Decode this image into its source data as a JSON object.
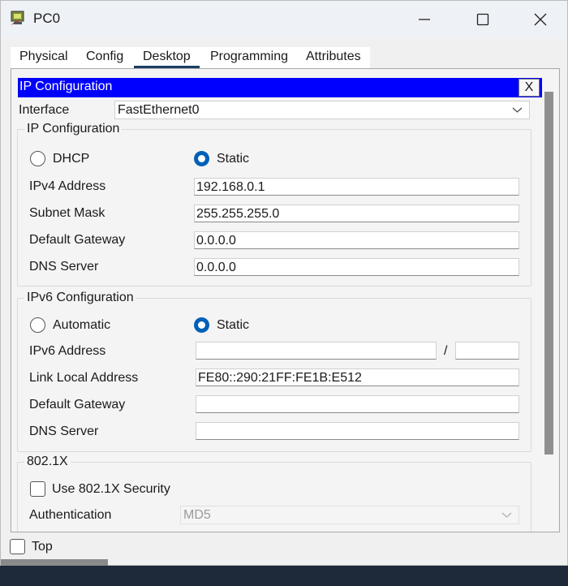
{
  "window": {
    "title": "PC0"
  },
  "tabs": [
    "Physical",
    "Config",
    "Desktop",
    "Programming",
    "Attributes"
  ],
  "active_tab": "Desktop",
  "panel": {
    "header_title": "IP Configuration",
    "close_label": "X",
    "interface_label": "Interface",
    "interface_value": "FastEthernet0"
  },
  "ipv4": {
    "group_title": "IP Configuration",
    "dhcp_label": "DHCP",
    "static_label": "Static",
    "selected": "Static",
    "address_label": "IPv4 Address",
    "address_value": "192.168.0.1",
    "mask_label": "Subnet Mask",
    "mask_value": "255.255.255.0",
    "gateway_label": "Default Gateway",
    "gateway_value": "0.0.0.0",
    "dns_label": "DNS Server",
    "dns_value": "0.0.0.0"
  },
  "ipv6": {
    "group_title": "IPv6 Configuration",
    "automatic_label": "Automatic",
    "static_label": "Static",
    "selected": "Static",
    "address_label": "IPv6 Address",
    "address_value": "",
    "slash": "/",
    "prefix_value": "",
    "link_local_label": "Link Local Address",
    "link_local_value": "FE80::290:21FF:FE1B:E512",
    "gateway_label": "Default Gateway",
    "gateway_value": "",
    "dns_label": "DNS Server",
    "dns_value": ""
  },
  "dot1x": {
    "group_title": "802.1X",
    "use_security_label": "Use 802.1X Security",
    "use_security_checked": false,
    "auth_label": "Authentication",
    "auth_value": "MD5"
  },
  "footer": {
    "top_label": "Top",
    "top_checked": false
  },
  "colors": {
    "header_bg": "#0000ff",
    "radio_selected": "#005fb8",
    "tab_underline": "#1c3e63"
  }
}
